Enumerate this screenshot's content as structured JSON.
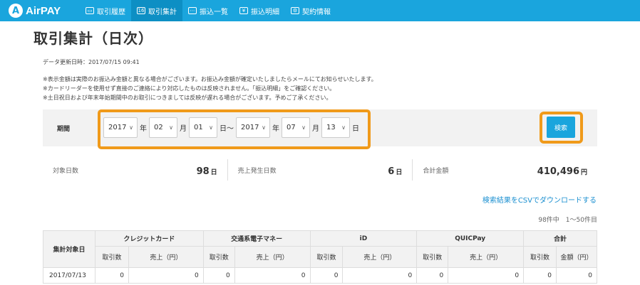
{
  "header": {
    "logo_mark": "A",
    "logo_text": "AirPAY",
    "nav": [
      {
        "icon": "card-icon",
        "glyph": "▭",
        "label": "取引履歴"
      },
      {
        "icon": "calendar-icon",
        "glyph": "16",
        "label": "取引集計",
        "active": true
      },
      {
        "icon": "deposit-list-icon",
        "glyph": "⋯",
        "label": "振込一覧"
      },
      {
        "icon": "yen-statement-icon",
        "glyph": "¥",
        "label": "振込明細"
      },
      {
        "icon": "contract-icon",
        "glyph": "⚙",
        "label": "契約情報"
      }
    ]
  },
  "page": {
    "title": "取引集計（日次）",
    "updated": "データ更新日時：2017/07/15 09:41",
    "notes": [
      "※表示金額は実際のお振込み金額と異なる場合がございます。お振込み金額が確定いたしましたらメールにてお知らせいたします。",
      "※カードリーダーを使用せず直接のご連絡により対応したものは反映されません。「振込明細」をご確認ください。",
      "※土日祝日および年末年始期間中のお取引につきましては反映が遅れる場合がございます。予めご了承ください。"
    ]
  },
  "filter": {
    "label": "期間",
    "from": {
      "year": "2017",
      "month": "02",
      "day": "01"
    },
    "to": {
      "year": "2017",
      "month": "07",
      "day": "13"
    },
    "units": {
      "year": "年",
      "month": "月",
      "day": "日",
      "range": "日～"
    },
    "search": "検索"
  },
  "summary": [
    {
      "label": "対象日数",
      "value": "98",
      "unit": "日"
    },
    {
      "label": "売上発生日数",
      "value": "6",
      "unit": "日"
    },
    {
      "label": "合計金額",
      "value": "410,496",
      "unit": "円"
    }
  ],
  "csv_link": "検索結果をCSVでダウンロードする",
  "count": "98件中　1〜50件目",
  "table": {
    "date_header": "集計対象日",
    "groups": [
      "クレジットカード",
      "交通系電子マネー",
      "iD",
      "QUICPay",
      "合計"
    ],
    "sub_count": "取引数",
    "sub_sales": "売上（円）",
    "sub_amount": "金額（円）",
    "rows": [
      {
        "date": "2017/07/13",
        "values": [
          "0",
          "0",
          "0",
          "0",
          "0",
          "0",
          "0",
          "0",
          "0",
          "0"
        ]
      }
    ]
  }
}
